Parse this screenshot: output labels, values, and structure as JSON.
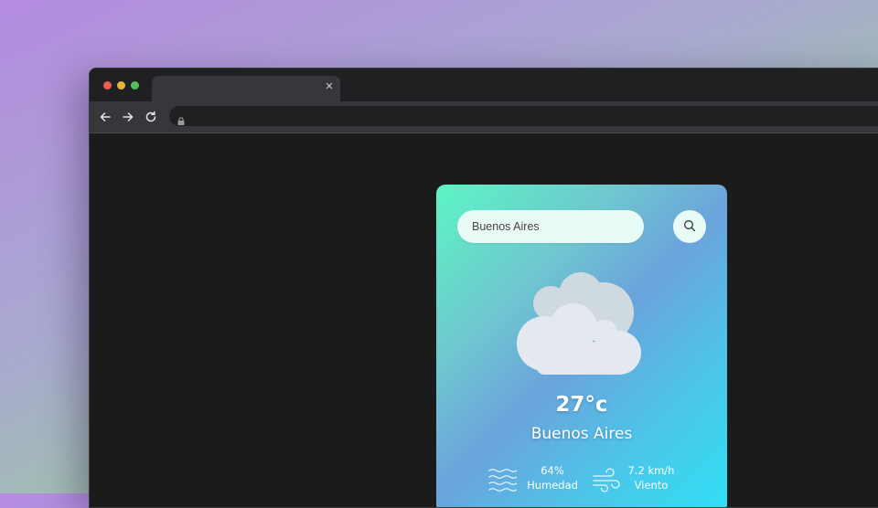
{
  "search": {
    "value": "Buenos Aires"
  },
  "weather": {
    "temperature": "27°c",
    "city": "Buenos Aires",
    "humidity": {
      "value": "64%",
      "label": "Humedad"
    },
    "wind": {
      "value": "7.2 km/h",
      "label": "Viento"
    }
  },
  "icons": {
    "window_controls": [
      "close-dot",
      "minimize-dot",
      "maximize-dot"
    ],
    "nav": [
      "back-arrow-icon",
      "forward-arrow-icon",
      "reload-icon",
      "lock-icon"
    ],
    "card": [
      "search-icon",
      "cloud-icon",
      "humidity-icon",
      "wind-icon"
    ]
  },
  "colors": {
    "window_close": "#ee5b54",
    "window_minimize": "#e8b73a",
    "window_maximize": "#4ec15a",
    "card_gradient_start": "#5cf5c4",
    "card_gradient_end": "#2ee0f4"
  }
}
